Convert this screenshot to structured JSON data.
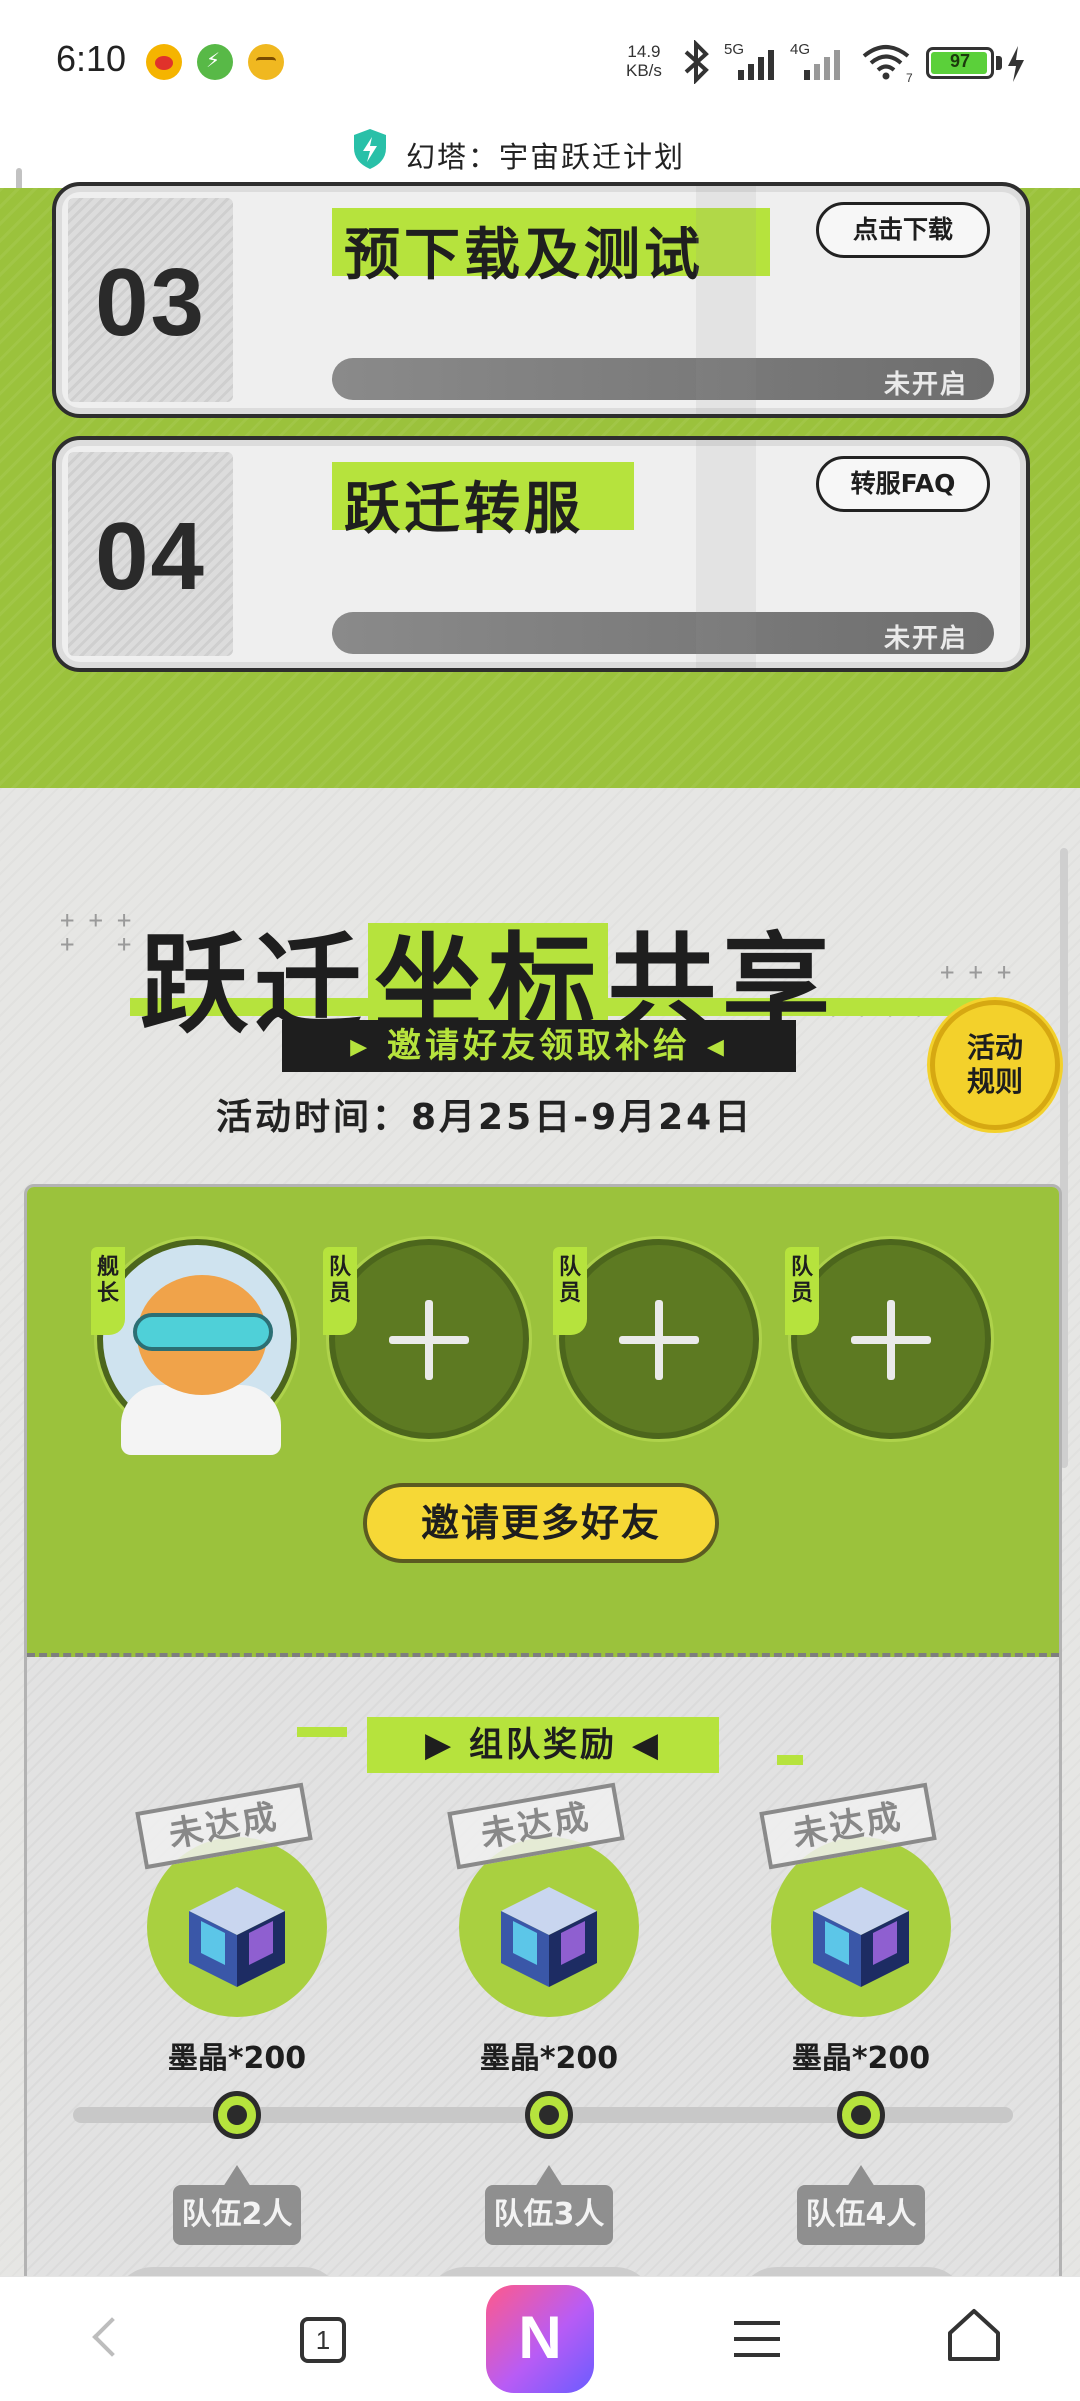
{
  "status_bar": {
    "time": "6:10",
    "network_speed_value": "14.9",
    "network_speed_unit": "KB/s",
    "signal_5g": "5G",
    "signal_4g": "4G",
    "wifi_label": "7",
    "battery": "97",
    "battery_level": 0.97,
    "icons": [
      "weibo-icon",
      "bolt-app-icon",
      "face-app-icon",
      "bluetooth-icon",
      "signal-5g-icon",
      "signal-4g-icon",
      "wifi-icon",
      "battery-icon",
      "charging-icon"
    ]
  },
  "title_bar": {
    "title": "幻塔：宇宙跃迁计划",
    "icon": "shield-bolt-icon"
  },
  "steps": [
    {
      "number": "03",
      "title": "预下载及测试",
      "button": "点击下载",
      "status": "未开启"
    },
    {
      "number": "04",
      "title": "跃迁转服",
      "button": "转服FAQ",
      "status": "未开启"
    }
  ],
  "share": {
    "title_part1": "跃迁",
    "title_highlight": "坐标",
    "title_part2": "共享",
    "subtitle": "▸ 邀请好友领取补给 ◂",
    "event_time": "活动时间：8月25日-9月24日",
    "rules_button_line1": "活动",
    "rules_button_line2": "规则"
  },
  "team": {
    "captain_tag": "舰长",
    "member_tag": "队员",
    "invite_button": "邀请更多好友"
  },
  "rewards": {
    "banner": "▶ 组队奖励 ◀",
    "items": [
      {
        "label": "墨晶*200",
        "stamp": "未达成",
        "tier": "队伍2人"
      },
      {
        "label": "墨晶*200",
        "stamp": "未达成",
        "tier": "队伍3人"
      },
      {
        "label": "墨晶*200",
        "stamp": "未达成",
        "tier": "队伍4人"
      }
    ]
  },
  "bottom_nav": {
    "tab_count": "1",
    "home_label": "N",
    "icons": [
      "back-icon",
      "tabs-icon",
      "browser-home-icon",
      "menu-icon",
      "home-icon"
    ]
  }
}
